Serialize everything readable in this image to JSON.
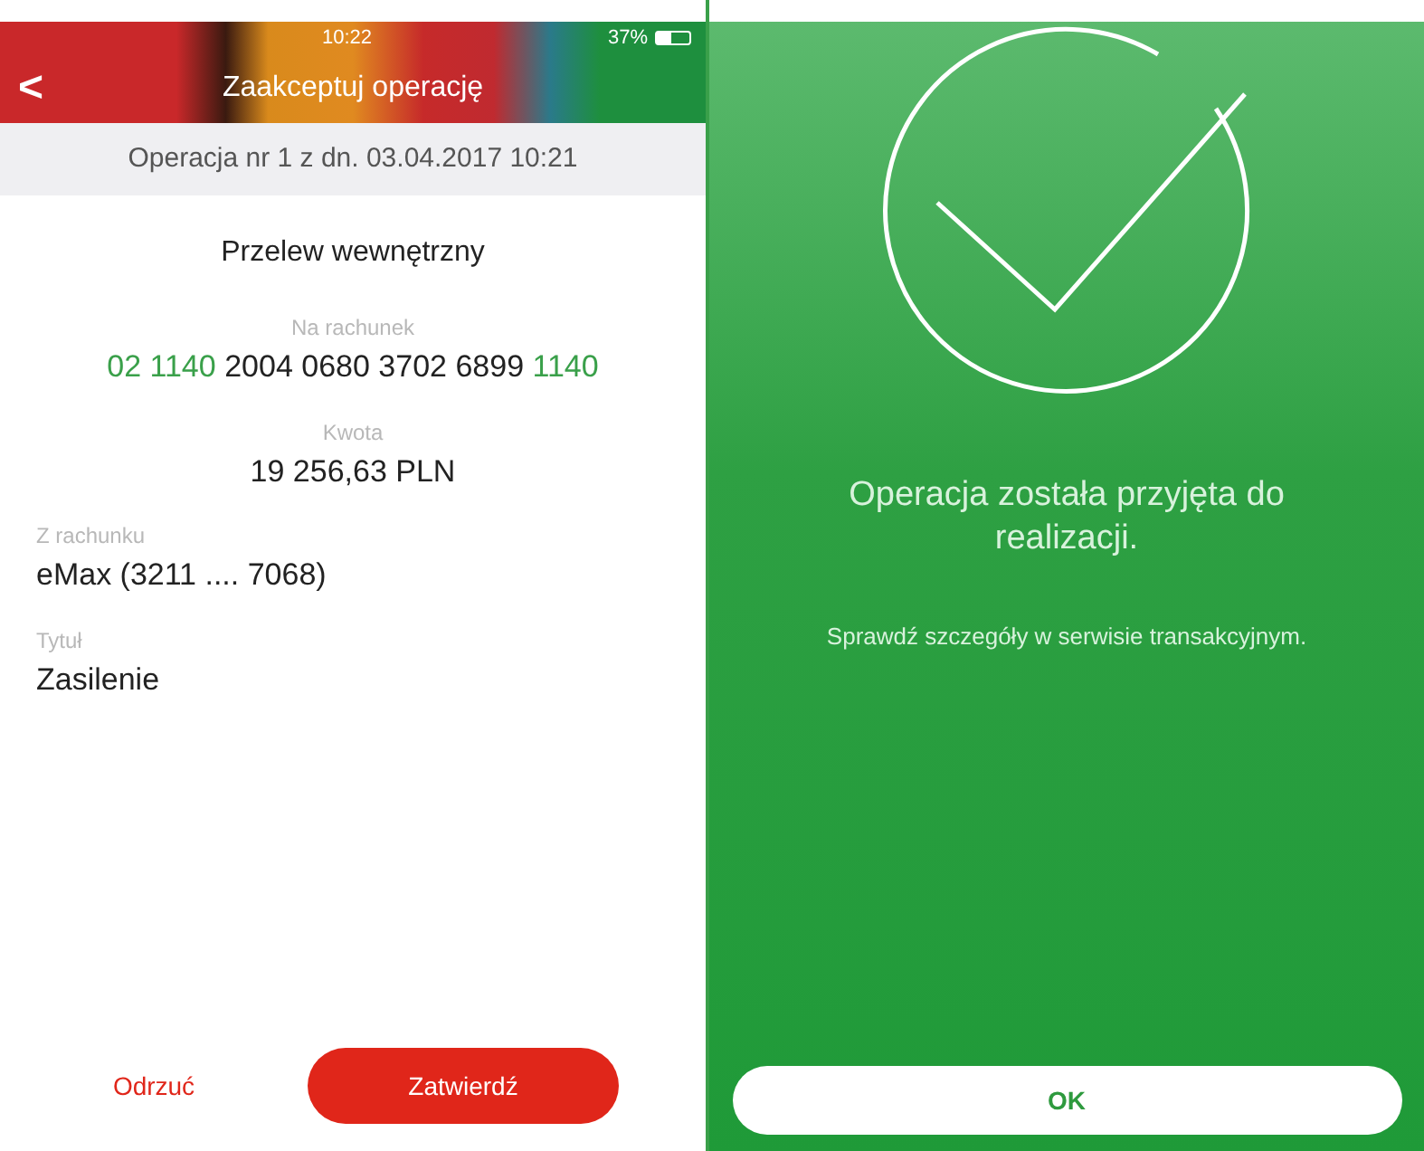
{
  "left_screen": {
    "status_bar": {
      "time": "10:22",
      "battery": "37%"
    },
    "header": {
      "back": "<",
      "title": "Zaakceptuj operację"
    },
    "subheader": "Operacja nr 1 z dn. 03.04.2017 10:21",
    "transfer_type": "Przelew wewnętrzny",
    "fields": [
      {
        "kind": "account",
        "label": "Na rachunek",
        "parts": [
          {
            "text": "02 1140",
            "highlight": true
          },
          {
            "text": "2004 0680 3702 6899",
            "highlight": false
          },
          {
            "text": "1140",
            "highlight": true
          }
        ]
      },
      {
        "kind": "amount",
        "label": "Kwota",
        "value": "19 256,63 PLN"
      },
      {
        "kind": "detail",
        "label": "Z rachunku",
        "value": "eMax (3211 .... 7068)"
      },
      {
        "kind": "detail",
        "label": "Tytuł",
        "value": "Zasilenie"
      }
    ],
    "buttons": [
      {
        "label": "Odrzuć",
        "kind": "text"
      },
      {
        "label": "Zatwierdź",
        "kind": "filled"
      }
    ]
  },
  "right_screen": {
    "message": "Operacja została przyjęta do realizacji.",
    "details": "Sprawdź szczegóły w serwisie transakcyjnym.",
    "button": "OK"
  }
}
